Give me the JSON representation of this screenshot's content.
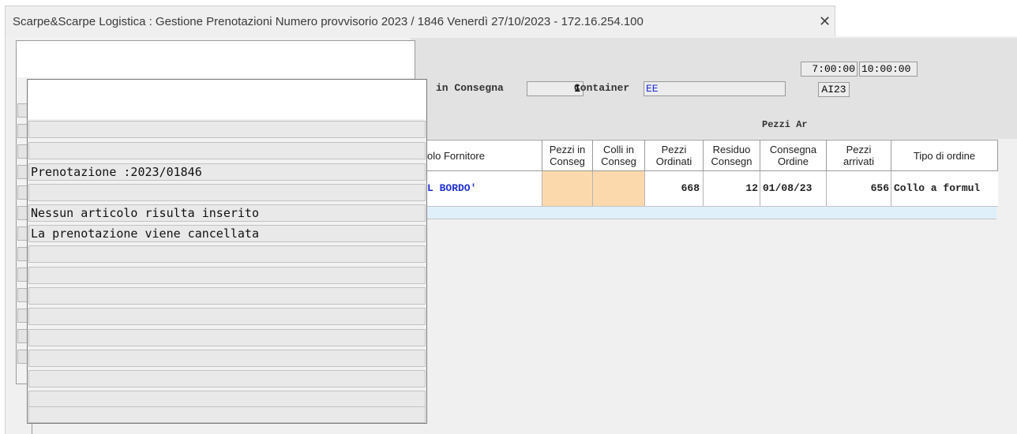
{
  "tab": {
    "title": "Scarpe&Scarpe Logistica : Gestione Prenotazioni  Numero provvisorio  2023  /  1846  Venerdì  27/10/2023   -  172.16.254.100",
    "close": "✕"
  },
  "header": {
    "in_consegna_label": "in Consegna",
    "in_consegna_value": "1",
    "container_label": "Container",
    "container_value": "EE",
    "time_from": "7:00:00",
    "time_to": "10:00:00",
    "code": "AI23",
    "pezzi_ar_label": "Pezzi Ar"
  },
  "grid": {
    "columns": [
      "olo Fornitore",
      "Pezzi in\nConseg",
      "Colli in\nConseg",
      "Pezzi\nOrdinati",
      "Residuo\nConsegn",
      "Consegna\nOrdine",
      "Pezzi\narrivati",
      "Tipo di ordine"
    ],
    "row": {
      "fornitore": "L BORDO'",
      "pezzi_in_consegna": "",
      "colli_in_consegna": "",
      "pezzi_ordinati": "668",
      "residuo_consegna": "12",
      "consegna_ordine": "01/08/23",
      "pezzi_arrivati": "656",
      "tipo_ordine": "Collo a formul"
    },
    "colors": {
      "edit_cell": "#fcd9ad",
      "selected_row": "#dff0fb",
      "blue_text": "#1f2fd6"
    }
  },
  "popup": {
    "lines": [
      "",
      "",
      "Prenotazione :2023/01846",
      "",
      "Nessun articolo risulta inserito",
      "La prenotazione viene cancellata",
      "",
      "",
      "",
      "",
      "",
      "",
      "",
      "",
      ""
    ]
  }
}
